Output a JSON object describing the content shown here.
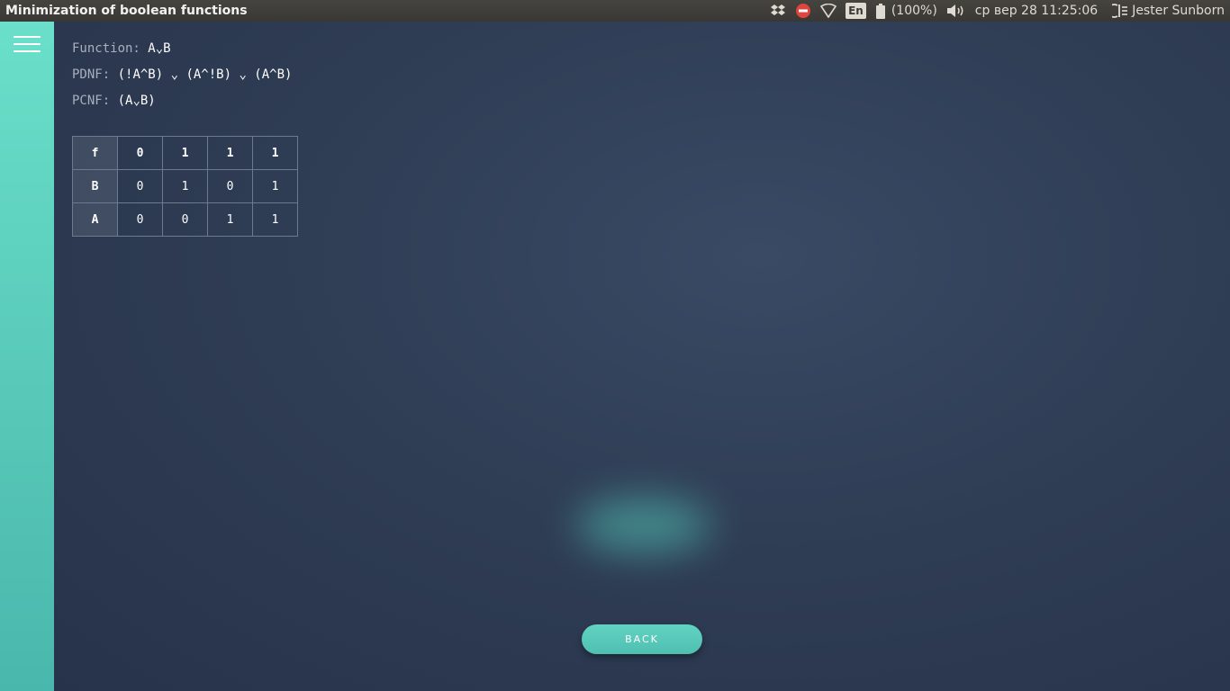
{
  "window": {
    "title": "Minimization of boolean functions"
  },
  "indicators": {
    "dropbox_icon": "dropbox-icon",
    "status_icon": "do-not-disturb-icon",
    "wifi_icon": "wifi-icon",
    "language": "En",
    "battery_icon": "battery-icon",
    "battery_text": "(100%)",
    "volume_icon": "volume-icon",
    "datetime": "ср вер 28 11:25:06",
    "session_icon": "session-icon",
    "user_name": "Jester Sunborn"
  },
  "colors": {
    "sidebar_top": "#6adfc9",
    "sidebar_bottom": "#4ab7ac",
    "main_bg": "#2f3d55",
    "accent": "#5ccbbd"
  },
  "sidebar": {
    "menu_icon": "hamburger-menu-icon"
  },
  "formulas": {
    "function_label": "Function:",
    "function_value": "A⌄B",
    "pdnf_label": "PDNF:",
    "pdnf_value": "(!A^B) ⌄ (A^!B) ⌄ (A^B)",
    "pcnf_label": "PCNF:",
    "pcnf_value": "(A⌄B)"
  },
  "truth_table": {
    "rows": [
      {
        "header": "f",
        "values": [
          "0",
          "1",
          "1",
          "1"
        ]
      },
      {
        "header": "B",
        "values": [
          "0",
          "1",
          "0",
          "1"
        ]
      },
      {
        "header": "A",
        "values": [
          "0",
          "0",
          "1",
          "1"
        ]
      }
    ]
  },
  "actions": {
    "back_label": "BACK"
  }
}
